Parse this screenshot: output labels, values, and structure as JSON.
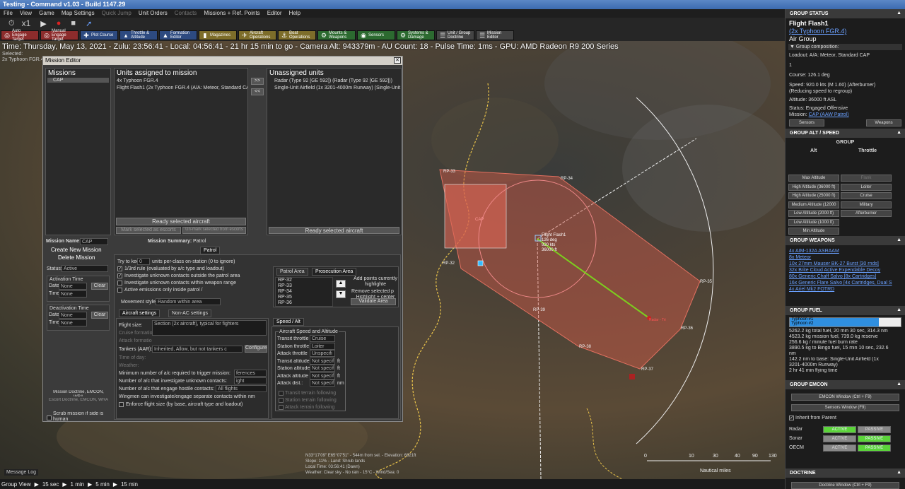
{
  "window": {
    "title": "Testing - Command v1.03 - Build 1147.29"
  },
  "menu": [
    "File",
    "View",
    "Game",
    "Map Settings",
    "Quick Jump",
    "Unit Orders",
    "Contacts",
    "Missions + Ref. Points",
    "Editor",
    "Help"
  ],
  "sim": {
    "speed": "x1"
  },
  "toolbar": [
    {
      "label": "Auto Engage Target",
      "color": "red"
    },
    {
      "label": "Manual Engage Target",
      "color": "red"
    },
    {
      "label": "Plot Course",
      "color": "blue"
    },
    {
      "label": "Throttle & Altitude",
      "color": "blue"
    },
    {
      "label": "Formation Editor",
      "color": "blue"
    },
    {
      "label": "Magazines",
      "color": "yellow"
    },
    {
      "label": "Aircraft Operations",
      "color": "yellow"
    },
    {
      "label": "Boat Operations",
      "color": "yellow"
    },
    {
      "label": "Mounts & Weapons",
      "color": "green"
    },
    {
      "label": "Sensors",
      "color": "green"
    },
    {
      "label": "Systems & Damage",
      "color": "green"
    },
    {
      "label": "Unit / Group Doctrine",
      "color": "grey"
    },
    {
      "label": "Mission Editor",
      "color": "grey"
    }
  ],
  "statusline": "Time: Thursday, May 13, 2021 - Zulu: 23:56:41 - Local: 04:56:41 - 21 hr 15 min to go -  Camera Alt: 943379m - AU Count: 18 - Pulse Time: 1ms - GPU: AMD Radeon R9 200 Series",
  "selected": {
    "label": "Selected:",
    "value": "2x Typhoon FGR.4"
  },
  "map": {
    "rps": [
      "RP-33",
      "RP-34",
      "RP-35",
      "RP-36",
      "RP-37",
      "RP-38",
      "RP-39",
      "RP-32"
    ],
    "unit_label": [
      "Flight Flash1",
      "126 deg",
      "920 kts",
      "36000 ft"
    ],
    "zone_label": "CAP",
    "target_label": "Radar - Tri",
    "cursor_info": [
      "N33°17'09\" E65°07'51\"  -  544m from sel.  -  Elevation: 6821ft",
      "Slope: 11%  -  Land: Shrub lands",
      "Local Time: 03:56:41 (Dawn)",
      "Weather: Clear sky - No rain - 15°C - Wind/Sea: 0"
    ],
    "scale": {
      "ticks": [
        "0",
        "10",
        "30",
        "40",
        "90",
        "130"
      ],
      "unit": "Nautical miles"
    }
  },
  "mission_editor": {
    "title": "Mission Editor",
    "missions_header": "Missions",
    "missions": [
      "CAP"
    ],
    "assigned_header": "Units assigned to mission",
    "assigned": [
      "4x Typhoon FGR.4",
      "Flight Flash1 (2x Typhoon FGR.4 (A/A: Meteor, Standard CAP"
    ],
    "unassigned_header": "Unassigned units",
    "unassigned": [
      "Radar (Type 92 [GE 592]) (Radar (Type 92 [GE 592]))",
      "Single-Unit Airfield (1x 3201-4000m Runway) (Single-Unit A"
    ],
    "ready_assigned": "Ready selected aircraft",
    "ready_unassigned": "Ready selected aircraft",
    "mark_escorts": "Mark selected as escorts",
    "unmark_escorts": "Un-mark selected from escorts",
    "move_right": ">>",
    "move_left": "<<",
    "mission_name_label": "Mission Name:",
    "mission_name": "CAP",
    "create_mission": "Create New Mission",
    "delete_mission": "Delete Mission",
    "status_label": "Status:",
    "status": "Active",
    "activation_label": "Activation Time",
    "activation_date": {
      "label": "Date",
      "value": "None"
    },
    "activation_time": {
      "label": "Time",
      "value": "None"
    },
    "deactivation_label": "Deactivation Time",
    "deactivation_date": {
      "label": "Date",
      "value": "None"
    },
    "deactivation_time": {
      "label": "Time",
      "value": "None"
    },
    "clear": "Clear",
    "doctrine_btn": "Mission Doctrine, EMCON, WRA",
    "escort_btn": "Escort Doctrine, EMCON, WRA",
    "scrub": "Scrub mission if side is human",
    "summary_label": "Mission Summary:",
    "summary": "Patrol",
    "patrol_tab": "Patrol",
    "keep_pre": "Try to kee",
    "keep_val": "0",
    "keep_post": "units per-class on-station (0 to ignore)",
    "options": [
      {
        "label": "1/3rd rule (evaluated by a/c type and loadout)",
        "checked": true
      },
      {
        "label": "Investigate unknown contacts outside the patrol area",
        "checked": true
      },
      {
        "label": "Investigate unknown contacts within weapon range",
        "checked": false
      },
      {
        "label": "Active emissions only inside patrol /",
        "checked": false
      }
    ],
    "movement_label": "Movement style:",
    "movement": "Random within area",
    "area_tabs": [
      "Patrol Area",
      "Prosecution Area"
    ],
    "area_points": [
      "RP-32",
      "RP-33",
      "RP-34",
      "RP-35",
      "RP-36"
    ],
    "add_points": "Add points currently highlighte",
    "remove_points": "Remove  selected p",
    "highlight": "Highlight + center on selected point",
    "validate": "Validate Area",
    "ac_tabs": [
      "Aircraft settings",
      "Non-AC settings"
    ],
    "flight_size_label": "Flight size:",
    "flight_size": "Section (2x aircraft), typical for fighters",
    "cruise_formation": "Cruise formatio",
    "attack_formation": "Attack formatio",
    "tankers_label": "Tankers (AAR):",
    "tankers": "Inherited, Allow, but not tankers c",
    "configure": "Configure",
    "time_of_day": "Time of day:",
    "weather": "Weather:",
    "min_ac_label": "Minimum number of a/c required to trigger mission:",
    "min_ac_val": "ferences",
    "investigate_label": "Number of a/c that investigate unknown contacts:",
    "investigate_val": "ight",
    "engage_label": "Number of a/c that engage hostile contacts:",
    "engage_val": "All flights",
    "wingmen": "Wingmen can investigate/engage separate contacts within",
    "wingmen_unit": "nm",
    "enforce": "Enforce flight size (by base, aircraft type and loadout)",
    "speed_tab": "Speed / Alt",
    "speed_group": "Aircraft Speed and Altitude",
    "speed_rows": [
      {
        "label": "Transit throttle",
        "value": "Cruise",
        "unit": ""
      },
      {
        "label": "Station throttle",
        "value": "Loiter",
        "unit": ""
      },
      {
        "label": "Attack throttle",
        "value": "Unspecifi",
        "unit": ""
      },
      {
        "label": "Transit altitude",
        "value": "Not specif",
        "unit": "ft"
      },
      {
        "label": "Station altitude",
        "value": "Not specif",
        "unit": "ft"
      },
      {
        "label": "Attack altitude",
        "value": "Not specif",
        "unit": "ft"
      },
      {
        "label": "Attack dist.:",
        "value": "Not specif",
        "unit": "nm"
      }
    ],
    "terrain": [
      "Transit terrain following",
      "Station terrain following",
      "Attack terrain following"
    ]
  },
  "right_panel": {
    "status_header": "GROUP STATUS",
    "group_name": "Flight Flash1",
    "group_type": "(2x Typhoon FGR.4)",
    "group_kind": "Air Group",
    "composition": "Group composition:",
    "loadout": "Loadout: A/A: Meteor, Standard CAP",
    "one": "1",
    "course": "Course: 126.1 deg",
    "speed": "Speed: 920.0 kts (M 1.60) (Afterburner)",
    "speed2": "(Reducing speed to regroup)",
    "altitude": "Altitude: 36000 ft ASL",
    "status": "Status: Engaged Offensive",
    "mission_pre": "Mission:",
    "mission": "CAP (AAW Patrol)",
    "sensors_btn": "Sensors",
    "weapons_btn": "Weapons",
    "alt_header": "GROUP ALT / SPEED",
    "group_lbl": "GROUP",
    "alt_lbl": "Alt",
    "throttle_lbl": "Throttle",
    "alt_buttons": [
      "Max Altitude",
      "High Altitude (36000 ft)",
      "High Altitude (25000 ft)",
      "Medium Altitude (12000",
      "Low Altitude (2000 ft)",
      "Low Altitude (1000 ft)",
      "Min Altitude"
    ],
    "throttle_buttons": [
      "Flank",
      "Loiter",
      "Cruise",
      "Military",
      "Afterburner"
    ],
    "weapons_header": "GROUP WEAPONS",
    "weapons": [
      "4x AIM-132A ASRAAM",
      "8x Meteor",
      "10x 27mm Mauser BK-27 Burst [30 rnds]",
      "32x Brite Cloud Active Expendable Decoy",
      "80x Generic Chaff Salvo [8x Cartridges]",
      "16x Generic Flare Salvo [4x Cartridges, Dual S",
      "4x Ariel Mk2 FOTRD"
    ],
    "fuel_header": "GROUP FUEL",
    "fuel_bars": [
      {
        "name": "Typhoon #1",
        "level": 0.8
      },
      {
        "name": "Typhoon #2",
        "level": 0.8
      }
    ],
    "fuel_text": [
      "5262.2 kg total fuel, 20 min 30 sec, 314.3 nm",
      "4523.2 kg mission fuel, 739.0 kg reserve",
      "256.6 kg / minute fuel burn rate",
      "3890.5 kg to Bingo fuel, 15 min 10 sec, 232.6",
      "nm",
      "142.2 nm to base: Single-Unit Airfield (1x",
      "3201-4000m Runway)",
      "2 hr 41 min flying time"
    ],
    "emcon_header": "GROUP EMCON",
    "emcon_window": "EMCON Window (Ctrl + F9)",
    "sensors_window": "Sensors Window (F9)",
    "inherit": "Inherit from Parent",
    "emcon_rows": [
      {
        "name": "Radar",
        "active": "ACTIVE",
        "passive": "PASSIVE",
        "on": "active"
      },
      {
        "name": "Sonar",
        "active": "ACTIVE",
        "passive": "PASSIVE",
        "on": "passive"
      },
      {
        "name": "OECM",
        "active": "ACTIVE",
        "passive": "PASSIVE",
        "on": "passive"
      }
    ],
    "doctrine_header": "DOCTRINE",
    "doctrine_window": "Doctrine Window (Ctrl + F9)"
  },
  "bottom": {
    "message_log": "Message Log",
    "group_view": "Group View",
    "steps": [
      "15 sec",
      "1 min",
      "5 min",
      "15 min"
    ]
  },
  "colors": {
    "zone": "#d45a4a",
    "course": "#7ccf1e",
    "link": "#6aa0ff",
    "active": "#5bd43a"
  }
}
